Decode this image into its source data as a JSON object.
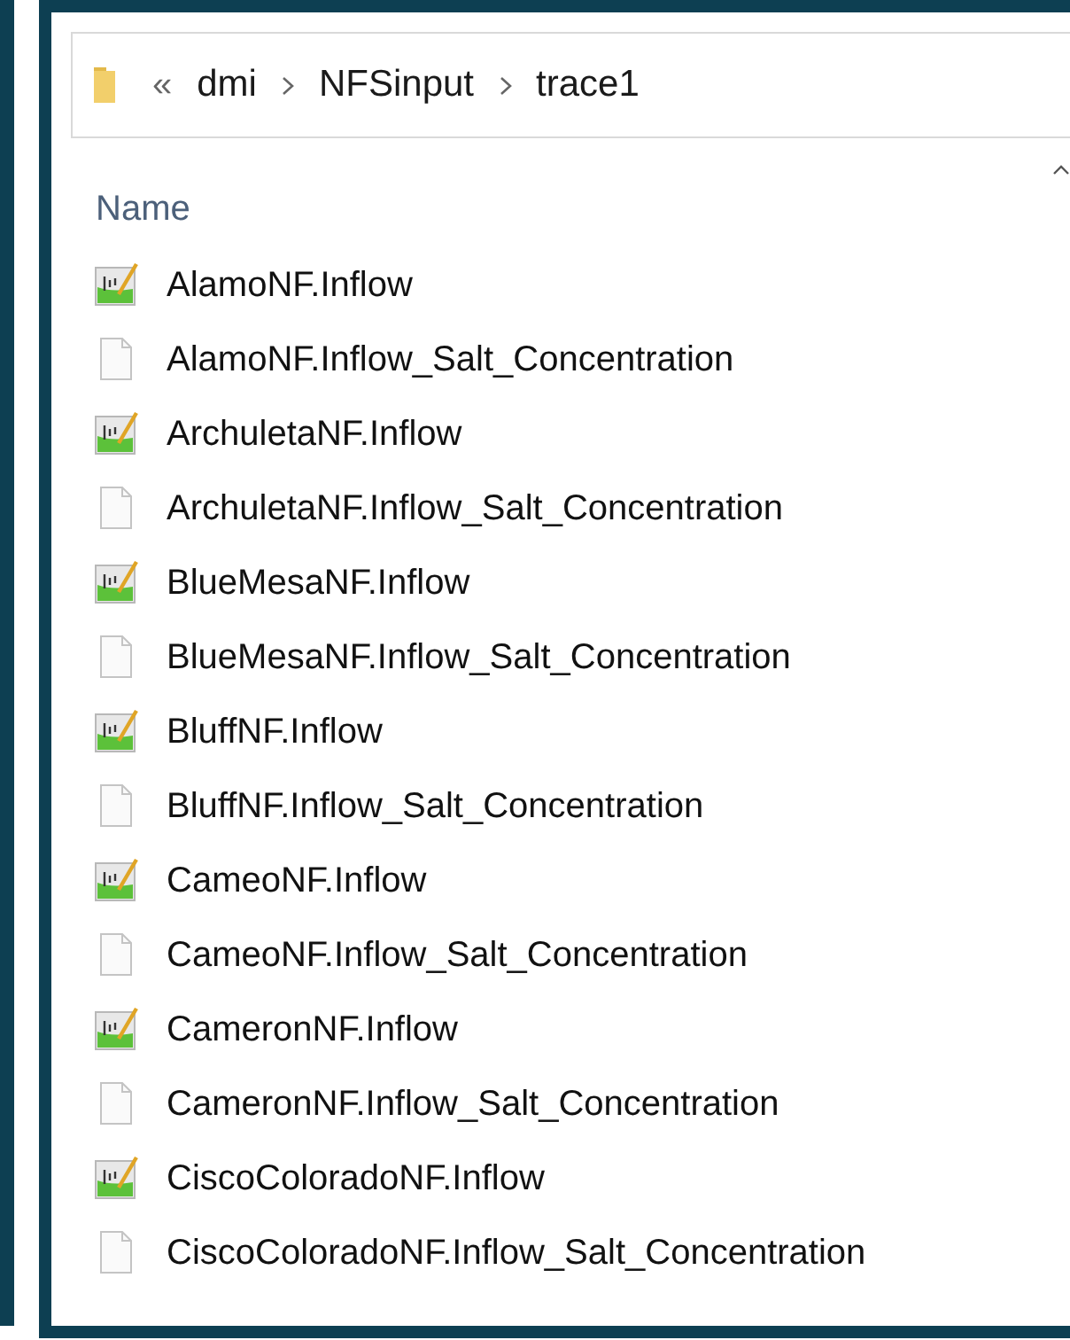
{
  "address_bar": {
    "overflow": "«",
    "path": [
      "dmi",
      "NFSinput",
      "trace1"
    ]
  },
  "column_header": {
    "label": "Name"
  },
  "files": [
    {
      "name": "AlamoNF.Inflow",
      "kind": "chart"
    },
    {
      "name": "AlamoNF.Inflow_Salt_Concentration",
      "kind": "blank"
    },
    {
      "name": "ArchuletaNF.Inflow",
      "kind": "chart"
    },
    {
      "name": "ArchuletaNF.Inflow_Salt_Concentration",
      "kind": "blank"
    },
    {
      "name": "BlueMesaNF.Inflow",
      "kind": "chart"
    },
    {
      "name": "BlueMesaNF.Inflow_Salt_Concentration",
      "kind": "blank"
    },
    {
      "name": "BluffNF.Inflow",
      "kind": "chart"
    },
    {
      "name": "BluffNF.Inflow_Salt_Concentration",
      "kind": "blank"
    },
    {
      "name": "CameoNF.Inflow",
      "kind": "chart"
    },
    {
      "name": "CameoNF.Inflow_Salt_Concentration",
      "kind": "blank"
    },
    {
      "name": "CameronNF.Inflow",
      "kind": "chart"
    },
    {
      "name": "CameronNF.Inflow_Salt_Concentration",
      "kind": "blank"
    },
    {
      "name": "CiscoColoradoNF.Inflow",
      "kind": "chart"
    },
    {
      "name": "CiscoColoradoNF.Inflow_Salt_Concentration",
      "kind": "blank"
    }
  ]
}
